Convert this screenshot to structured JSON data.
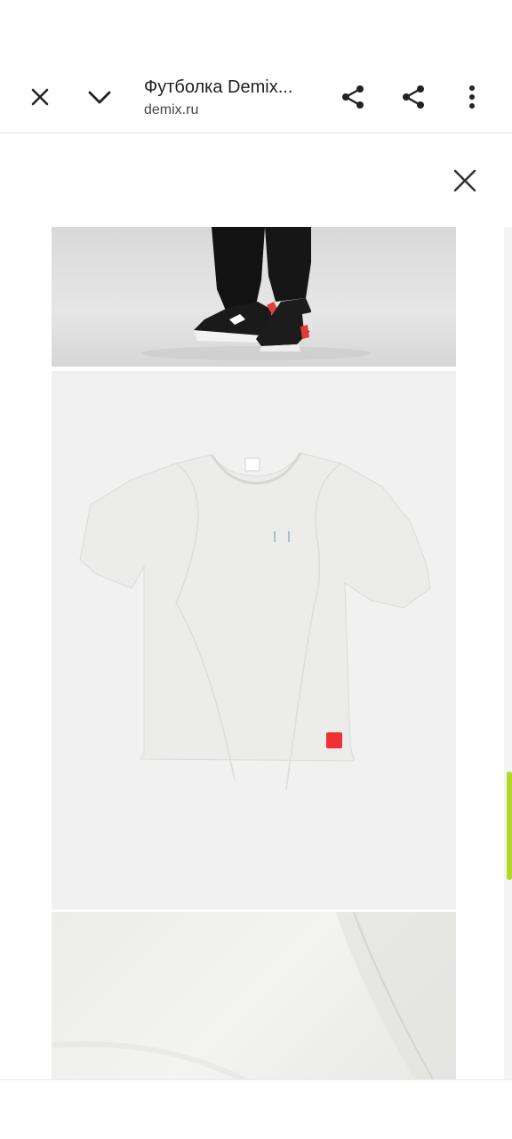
{
  "toolbar": {
    "title": "Футболка Demix...",
    "url": "demix.ru"
  },
  "icons": {
    "close": "close-icon",
    "collapse": "chevron-down-icon",
    "share": "share-icon",
    "share_alt": "share-icon",
    "menu": "more-vert-icon",
    "viewer_close": "close-icon"
  },
  "gallery": {
    "images": [
      "product-photo-sneakers",
      "product-photo-tshirt",
      "product-photo-fabric-detail"
    ]
  },
  "colors": {
    "accent_scrollbar": "#b6d82b",
    "logo_patch": "#ef3135",
    "tshirt": "#ececea"
  }
}
